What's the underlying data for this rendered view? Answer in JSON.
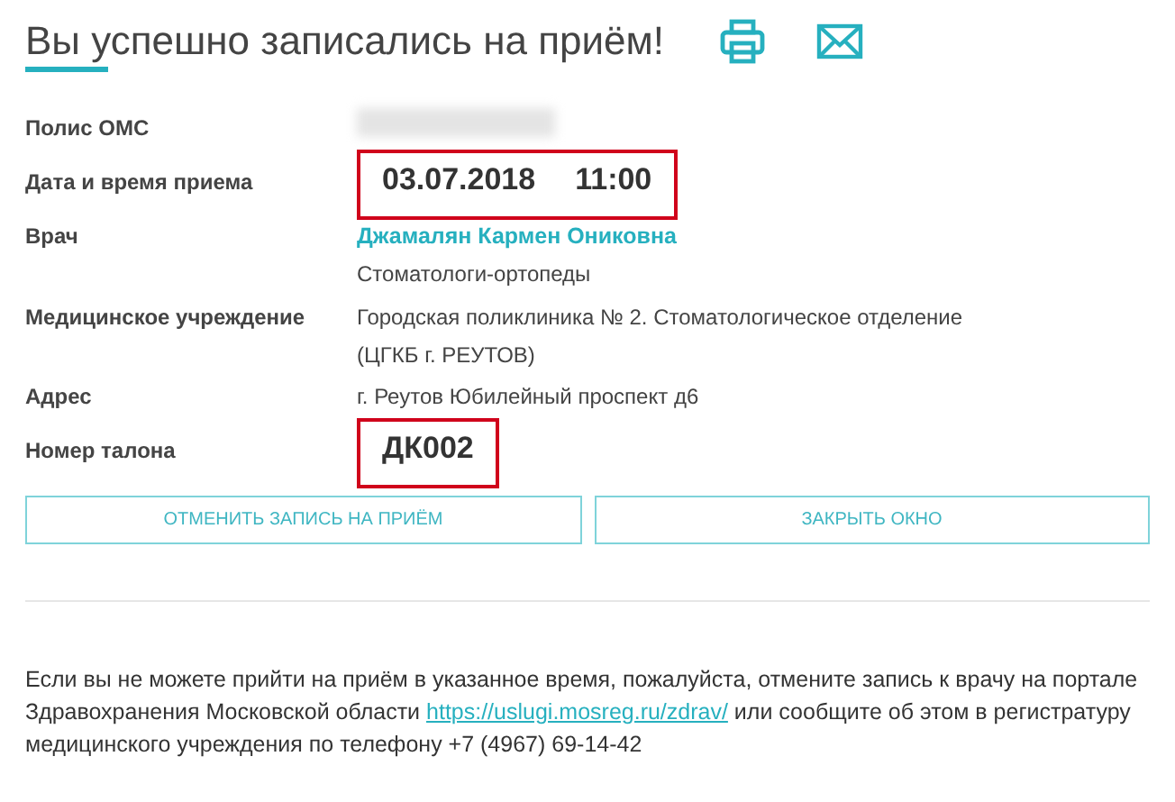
{
  "title": "Вы успешно записались на приём!",
  "rows": [
    {
      "label": "Полис ОМС",
      "kind": "hidden",
      "values": []
    },
    {
      "label": "Дата и время приема",
      "kind": "highlight",
      "values": [
        "03.07.2018",
        "11:00"
      ]
    },
    {
      "label": "Врач",
      "kind": "doctor",
      "values": [
        "Джамалян Кармен Ониковна",
        "Стоматологи-ортопеды"
      ]
    },
    {
      "label": "Медицинское учреждение",
      "kind": "text",
      "values": [
        "Городская поликлиника № 2. Стоматологическое отделение",
        "(ЦГКБ г. РЕУТОВ)"
      ]
    },
    {
      "label": "Адрес",
      "kind": "text",
      "values": [
        "г. Реутов Юбилейный проспект д6"
      ]
    },
    {
      "label": "Номер талона",
      "kind": "highlight",
      "values": [
        "ДК002"
      ]
    }
  ],
  "buttons": [
    "ОТМЕНИТЬ ЗАПИСЬ НА ПРИЁМ",
    "ЗАКРЫТЬ ОКНО"
  ],
  "notice": {
    "before": "Если вы не можете прийти на приём в указанное время, пожалуйста, отмените запись к врачу на портале Здравохранения Московской области ",
    "link": "https://uslugi.mosreg.ru/zdrav/",
    "after": " или сообщите об этом в регистратуру медицинского учреждения по телефону +7 (4967) 69-14-42"
  }
}
